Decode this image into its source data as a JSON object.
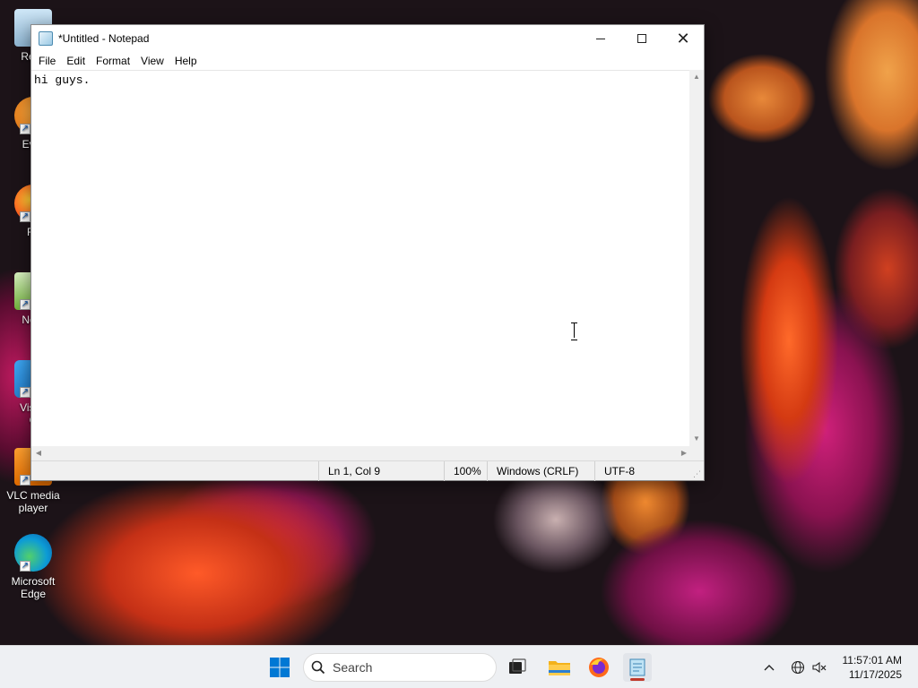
{
  "desktop": {
    "icons": [
      {
        "label": "Recy",
        "icon": "recycle-bin-icon"
      },
      {
        "label": "Ever",
        "icon": "everything-icon"
      },
      {
        "label": "Fir",
        "icon": "firefox-icon"
      },
      {
        "label": "Note",
        "icon": "notepad-plus-icon"
      },
      {
        "label": "Visua",
        "label2": "C",
        "icon": "vscode-icon"
      },
      {
        "label": "VLC media",
        "label2": "player",
        "icon": "vlc-icon"
      },
      {
        "label": "Microsoft",
        "label2": "Edge",
        "icon": "edge-icon"
      }
    ]
  },
  "window": {
    "title": "*Untitled - Notepad",
    "menu": [
      "File",
      "Edit",
      "Format",
      "View",
      "Help"
    ],
    "content": "hi guys.",
    "status": {
      "position": "Ln 1, Col 9",
      "zoom": "100%",
      "line_endings": "Windows (CRLF)",
      "encoding": "UTF-8"
    }
  },
  "taskbar": {
    "search_label": "Search",
    "clock_time": "11:57:01 AM",
    "clock_date": "11/17/2025"
  },
  "colors": {
    "taskbar_bg": "#eef0f3",
    "start_blue": "#0078d4",
    "active_indicator": "#c0392b"
  }
}
